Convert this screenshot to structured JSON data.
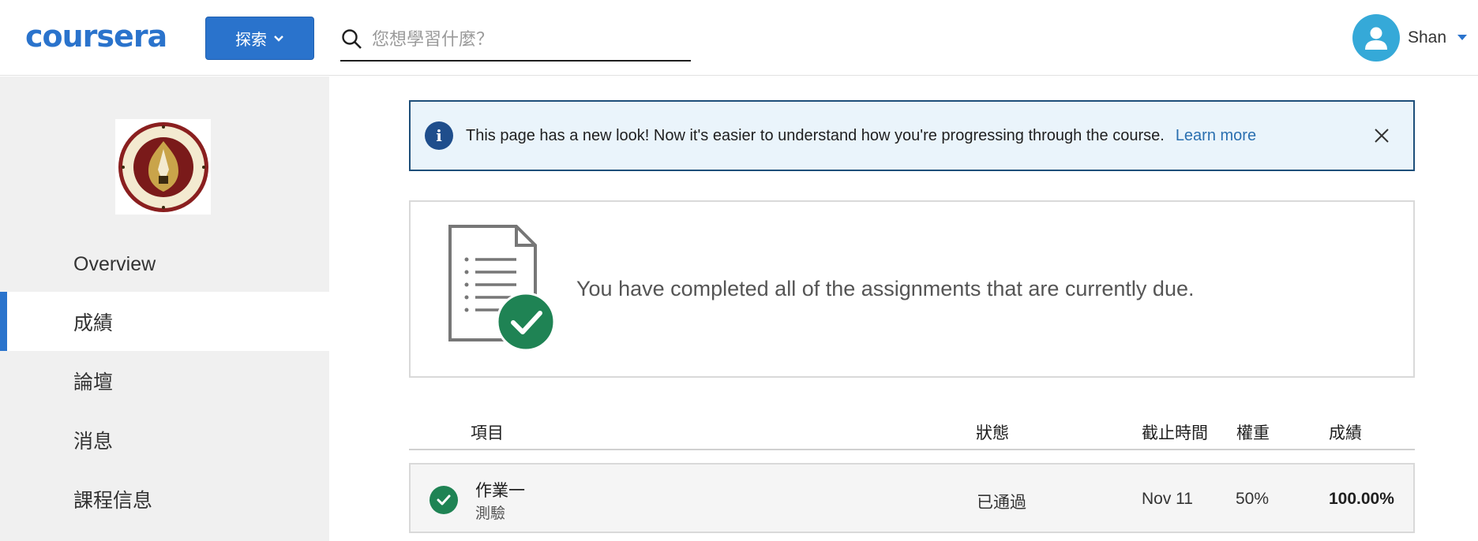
{
  "header": {
    "logo": "coursera",
    "explore_label": "探索",
    "search_placeholder": "您想學習什麼？",
    "username": "Shan"
  },
  "sidebar": {
    "items": [
      {
        "label": "Overview"
      },
      {
        "label": "成績"
      },
      {
        "label": "論壇"
      },
      {
        "label": "消息"
      },
      {
        "label": "課程信息"
      }
    ],
    "active_index": 1
  },
  "banner": {
    "message": "This page has a new look! Now it's easier to understand how you're progressing through the course.",
    "link": "Learn more"
  },
  "status_card": {
    "message": "You have completed all of the assignments that are currently due."
  },
  "table": {
    "headers": {
      "item": "項目",
      "status": "狀態",
      "due": "截止時間",
      "weight": "權重",
      "grade": "成績"
    },
    "rows": [
      {
        "title": "作業一",
        "type": "測驗",
        "status": "已通過",
        "due": "Nov 11",
        "weight": "50%",
        "grade": "100.00%"
      }
    ]
  },
  "colors": {
    "brand": "#2a73cc",
    "banner_bg": "#eaf4fb",
    "banner_border": "#1e4f7a",
    "success": "#1f8354",
    "sidebar_bg": "#f0f0f0"
  }
}
